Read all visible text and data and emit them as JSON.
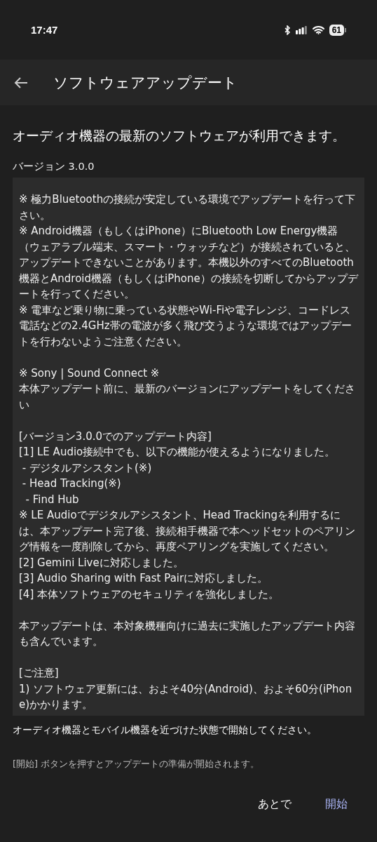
{
  "status_bar": {
    "time": "17:47",
    "battery": "61"
  },
  "app_bar": {
    "title": "ソフトウェアアップデート"
  },
  "heading": "オーディオ機器の最新のソフトウェアが利用できます。",
  "version": "バージョン 3.0.0",
  "release_notes": [
    [
      "※ 極力Bluetoothの接続が安定している環境でアップデートを行って下さい。",
      "※ Android機器（もしくはiPhone）にBluetooth Low Energy機器（ウェアラブル端末、スマート・ウォッチなど）が接続されていると、アップデートできないことがあります。本機以外のすべてのBluetooth機器とAndroid機器（もしくはiPhone）の接続を切断してからアップデートを行ってください。",
      "※ 電車など乗り物に乗っている状態やWi-Fiや電子レンジ、コードレス電話などの2.4GHz帯の電波が多く飛び交うような環境ではアップデートを行わないようご注意ください。"
    ],
    [
      "※ Sony | Sound Connect ※",
      "本体アップデート前に、最新のバージョンにアップデートをしてください"
    ],
    [
      "[バージョン3.0.0でのアップデート内容]",
      "[1] LE Audio接続中でも、以下の機能が使えるようになりました。",
      " - デジタルアシスタント(※)",
      " - Head Tracking(※)",
      "  - Find Hub",
      "※ LE Audioでデジタルアシスタント、Head Trackingを利用するには、本アップデート完了後、接続相手機器で本ヘッドセットのペアリング情報を一度削除してから、再度ペアリングを実施してください。",
      "[2] Gemini Liveに対応しました。",
      "[3] Audio Sharing with Fast Pairに対応しました。",
      "[4] 本体ソフトウェアのセキュリティを強化しました。"
    ],
    [
      "本アップデートは、本対象機種向けに過去に実施したアップデート内容も含んでいます。"
    ],
    [
      "[ご注意]",
      "1) ソフトウェア更新には、およそ40分(Android)、およそ60分(iPhone)かかります。"
    ]
  ],
  "instruction": "オーディオ機器とモバイル機器を近づけた状態で開始してください。",
  "hint": "[開始] ボタンを押すとアップデートの準備が開始されます。",
  "buttons": [
    {
      "label": "あとで",
      "kind": "secondary"
    },
    {
      "label": "開始",
      "kind": "primary"
    }
  ]
}
